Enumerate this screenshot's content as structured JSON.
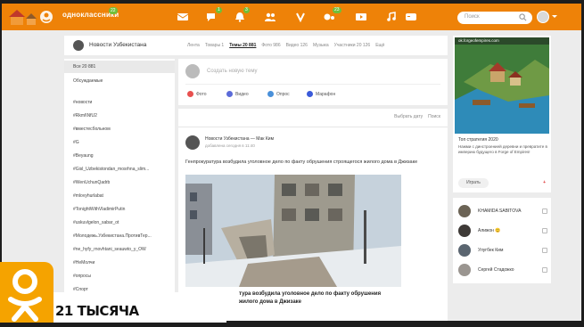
{
  "topbar": {
    "brand": "одноклассники",
    "brand_badge": "22",
    "nav_badges": [
      "",
      "1",
      "3",
      "",
      "",
      "23",
      "",
      ""
    ],
    "search_placeholder": "Поиск"
  },
  "group": {
    "name": "Новости Узбекистана",
    "tabs": [
      "Лента",
      "Товары 1",
      "Темы 20 881",
      "Фото 986",
      "Видео 126",
      "Музыка",
      "Участники 20 126",
      "Ещё"
    ],
    "active_tab_index": 2
  },
  "sidebar": {
    "header": "Все 20 881",
    "items": [
      "Обсуждаемые",
      "#новости",
      "#Rkml\\NfU2",
      "#вместесбольном",
      "#G",
      "#Beyaung",
      "#Gisl_Uzbekistondan_mosrhna_slim...",
      "#WenUchunQadrb",
      "#mlovyhurlabat",
      "#TonightWithVladimirPutin",
      "#uskuvlgelon_sabar_ot",
      "#Молодежь.Узбекистана.ПротивТер...",
      "#ne_hyfy_rnovhtani_seauwto_y_OW",
      "#НеМолчи",
      "#опросы",
      "#Спорт"
    ]
  },
  "composer": {
    "placeholder": "Создать новую тему",
    "actions": [
      "Фото",
      "Видео",
      "Опрос",
      "Марафон"
    ]
  },
  "feed": {
    "tools": [
      "Выбрать дату",
      "Поиск"
    ],
    "post": {
      "author": "Новости Узбекистана — Мак Ким",
      "time": "добавлена сегодня в 11:40",
      "text": "Генпрокуратура возбудила уголовное дело по факту обрушения строящегося жилого дома в Джизаке",
      "caption": "тура возбудила уголовное дело по факту обрушения жилого дома в Джизаке"
    }
  },
  "ad": {
    "header": "ok.forgeofempires.com",
    "title": "Топ стратегия 2020",
    "desc": "Нажми с динстроенией деревни и превратите в империю будущего в Forge of Empires!",
    "play": "Играть",
    "mark": "+"
  },
  "friends": [
    {
      "name": "KHAMIDA SABITOVA"
    },
    {
      "name": "Алижон 😊"
    },
    {
      "name": "Улугбек Ким"
    },
    {
      "name": "Сергей Стадожко"
    }
  ],
  "overlay": {
    "caption": "21 ТЫСЯЧА"
  },
  "colors": {
    "accent": "#ee8208",
    "badge": "#6fbf3a",
    "ok_logo": "#f5a300"
  }
}
